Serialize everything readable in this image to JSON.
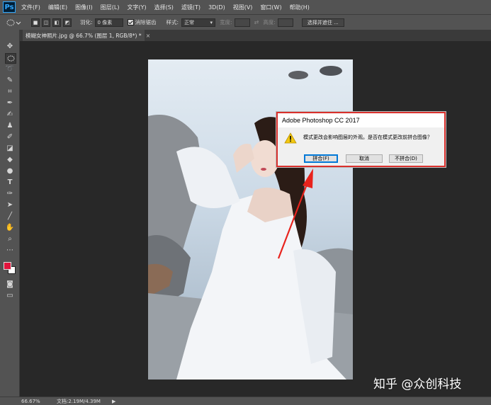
{
  "app": {
    "logo": "Ps"
  },
  "menu": {
    "items": [
      "文件(F)",
      "编辑(E)",
      "图像(I)",
      "图层(L)",
      "文字(Y)",
      "选择(S)",
      "滤镜(T)",
      "3D(D)",
      "视图(V)",
      "窗口(W)",
      "帮助(H)"
    ]
  },
  "options": {
    "feather_label": "羽化:",
    "feather_value": "0 像素",
    "antialias_label": "消除锯齿",
    "style_label": "样式:",
    "style_value": "正常",
    "width_label": "宽度:",
    "height_label": "高度:",
    "select_mask_button": "选择并遮住 ..."
  },
  "document": {
    "tab_title": "模糊女神照片.jpg @ 66.7% (图层 1, RGB/8*) *",
    "close": "×"
  },
  "dialog": {
    "title": "Adobe Photoshop CC 2017",
    "message": "模式更改会影响图层的外观。是否在模式更改前拼合图像？",
    "buttons": {
      "flatten": "拼合(F)",
      "cancel": "取消",
      "dont_flatten": "不拼合(D)"
    }
  },
  "status": {
    "zoom": "66.67%",
    "doc_info": "文档:2.19M/4.39M"
  },
  "watermark": "知乎 @众创科技",
  "colors": {
    "foreground": "#e0143c",
    "background": "#ffffff",
    "annotation_red": "#e8231d"
  }
}
